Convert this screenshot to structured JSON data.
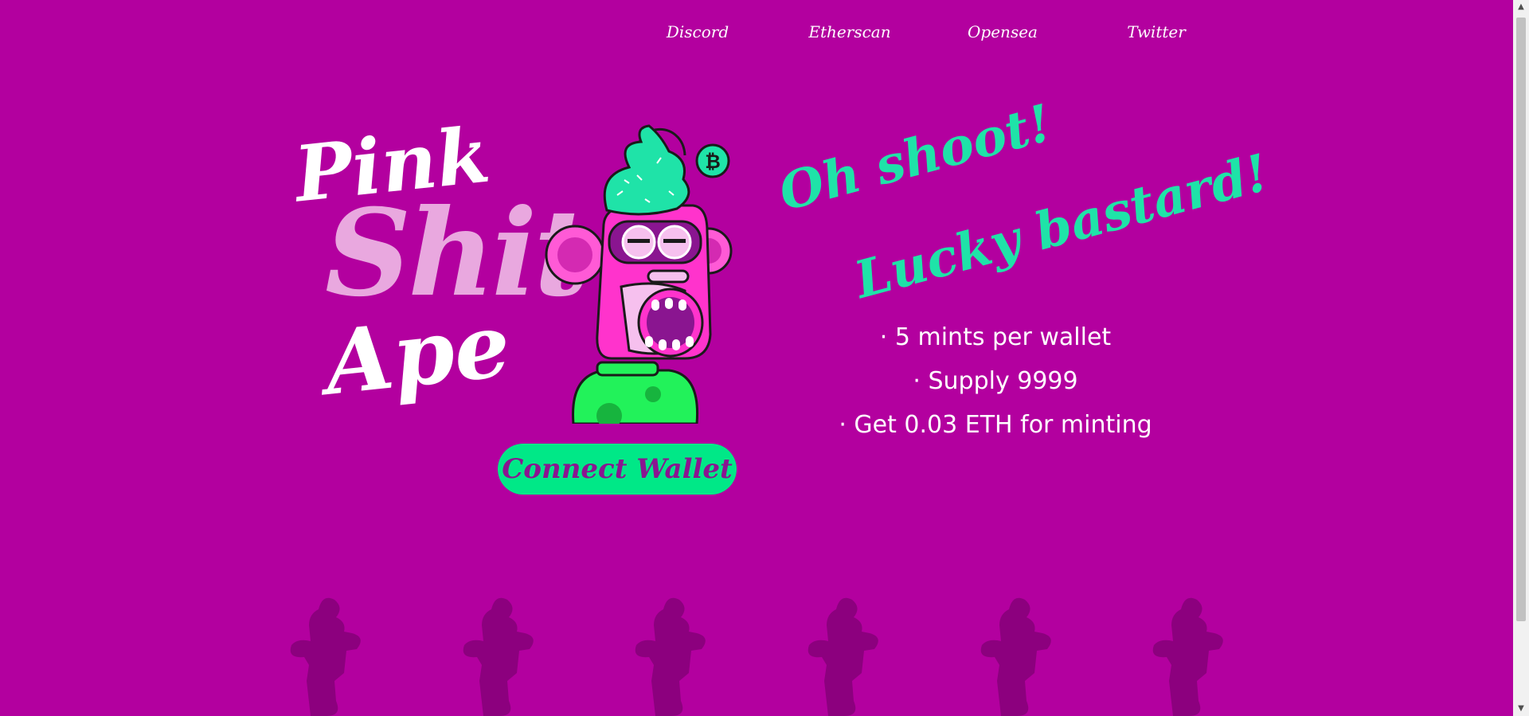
{
  "nav": {
    "items": [
      "Discord",
      "Etherscan",
      "Opensea",
      "Twitter"
    ]
  },
  "hero": {
    "title": {
      "line1": "Pink",
      "line2": "Shit",
      "line3": "Ape"
    },
    "connect_label": "Connect Wallet",
    "tagline": {
      "line1": "Oh shoot!",
      "line2": "Lucky bastard!"
    },
    "features": [
      "· 5 mints per wallet",
      "· Supply 9999",
      "· Get 0.03 ETH for minting"
    ]
  },
  "ape": {
    "coin_glyph": "₿"
  },
  "colors": {
    "background": "#b3009f",
    "accent_green": "#00e887",
    "tagline_green": "#1fe3a8",
    "title_pink": "#e9a8df",
    "button_text": "#8a1590",
    "silhouette": "#8c007e"
  },
  "icons": {
    "scroll_up": "triangle-up-icon",
    "scroll_down": "triangle-down-icon"
  }
}
